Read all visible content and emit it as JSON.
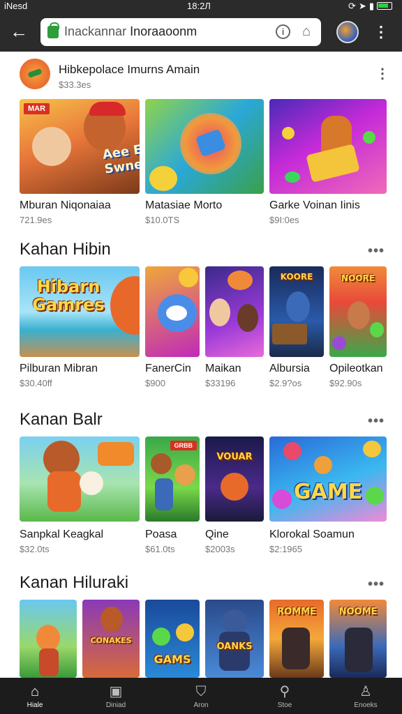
{
  "status_bar": {
    "carrier": "iNesd",
    "time": "18:2Л"
  },
  "browser": {
    "url_prefix": "Inackannar",
    "url_domain": "Inoraaoonm",
    "back_icon": "arrow-left-icon",
    "menu_icon": "more-vert-icon"
  },
  "app_header": {
    "title": "Hibkepolace Imurns Amain",
    "subtitle": "$33.3es"
  },
  "featured": [
    {
      "title": "Mburan Niqonaiaa",
      "price": "721.9es",
      "badge": "MAR",
      "art_text": "Aee Elnans Swnemepe"
    },
    {
      "title": "Matasiae Morto",
      "price": "$10.0TS",
      "art_text": ""
    },
    {
      "title": "Garke Voinan Iinis",
      "price": "$9I:0es",
      "art_text": ""
    }
  ],
  "sections": [
    {
      "title": "Kahan Hibin",
      "items": [
        {
          "title": "Pilburan Mibran",
          "price": "$30.40ff",
          "art_text": "Hibarn Gamres"
        },
        {
          "title": "FanerCin",
          "price": "$900",
          "art_text": ""
        },
        {
          "title": "Maikan",
          "price": "$33196",
          "art_text": ""
        },
        {
          "title": "Albursia",
          "price": "$2.9?os",
          "art_text": "KOORE"
        },
        {
          "title": "Opileotkan",
          "price": "$92.90s",
          "art_text": "NOORE"
        }
      ]
    },
    {
      "title": "Kanan Balr",
      "items": [
        {
          "title": "Sanpkal Keagkal",
          "price": "$32.0ts",
          "art_text": ""
        },
        {
          "title": "Poasa",
          "price": "$61.0ts",
          "art_text": "GRBB"
        },
        {
          "title": "Qine",
          "price": "$2003s",
          "art_text": "VOUAR"
        },
        {
          "title": "Klorokal Soamun",
          "price": "$2:1965",
          "art_text": "GAME"
        }
      ]
    },
    {
      "title": "Kanan Hiluraki",
      "items": [
        {
          "title": "",
          "price": "",
          "art_text": ""
        },
        {
          "title": "",
          "price": "",
          "art_text": "CONAKES"
        },
        {
          "title": "",
          "price": "",
          "art_text": "GAMS"
        },
        {
          "title": "",
          "price": "",
          "art_text": "OANKS"
        },
        {
          "title": "",
          "price": "",
          "art_text": "ROMME"
        },
        {
          "title": "",
          "price": "",
          "art_text": "NOOME"
        }
      ]
    }
  ],
  "bottom_nav": [
    {
      "label": "Hiale",
      "icon": "home-icon",
      "active": true
    },
    {
      "label": "Diniad",
      "icon": "library-icon"
    },
    {
      "label": "Aron",
      "icon": "bag-icon"
    },
    {
      "label": "Stoe",
      "icon": "search-icon"
    },
    {
      "label": "Enoeks",
      "icon": "person-icon"
    }
  ]
}
